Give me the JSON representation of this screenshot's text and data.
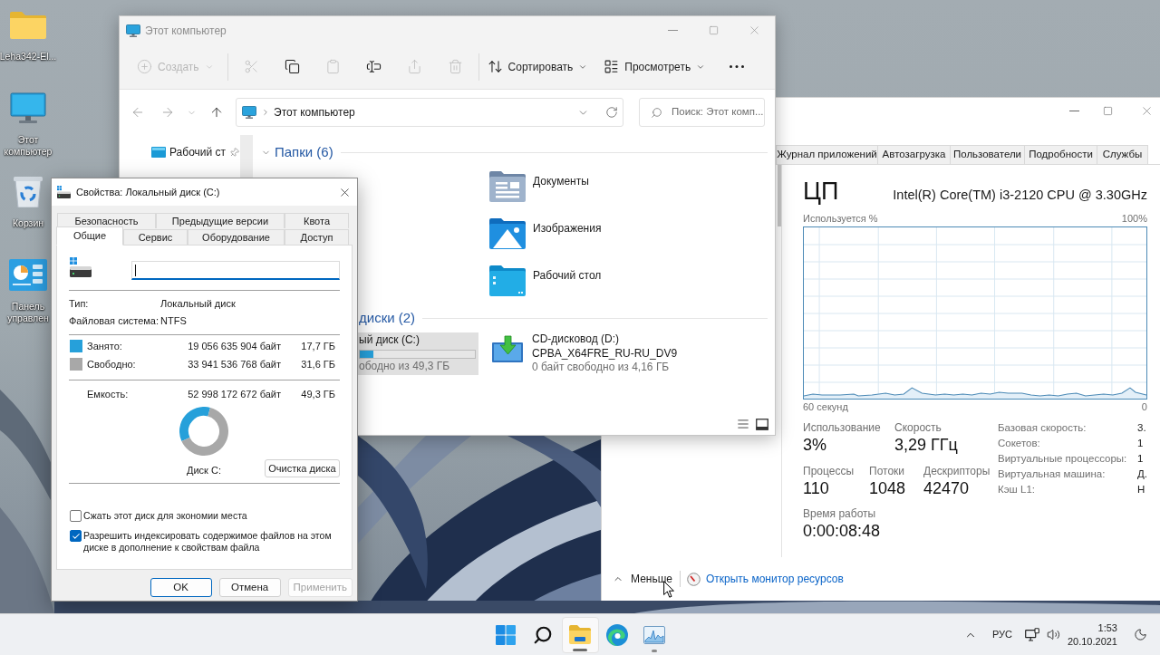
{
  "desktop": {
    "icons": [
      {
        "kind": "folder",
        "label": "Leha342-El..."
      },
      {
        "kind": "computer",
        "label": "Этот компьютер"
      },
      {
        "kind": "recycle-bin",
        "label": "Корзин"
      },
      {
        "kind": "control-panel",
        "label": "Панель управлен"
      }
    ]
  },
  "task_manager": {
    "tabs": [
      {
        "label": "Журнал приложений",
        "selected": false
      },
      {
        "label": "Автозагрузка",
        "selected": false
      },
      {
        "label": "Пользователи",
        "selected": false
      },
      {
        "label": "Подробности",
        "selected": false
      },
      {
        "label": "Службы",
        "selected": false
      }
    ],
    "cpu": {
      "title": "ЦП",
      "model": "Intel(R) Core(TM) i3-2120 CPU @ 3.30GHz",
      "graph_caption": "Используется %",
      "graph_max": "100%",
      "graph_span": "60 секунд",
      "graph_end": "0",
      "stats": [
        {
          "label": "Использование",
          "value": "3%"
        },
        {
          "label": "Скорость",
          "value": "3,29 ГГц"
        }
      ],
      "counts": [
        {
          "label": "Процессы",
          "value": "110"
        },
        {
          "label": "Потоки",
          "value": "1048"
        },
        {
          "label": "Дескрипторы",
          "value": "42470"
        }
      ],
      "uptime": {
        "label": "Время работы",
        "value": "0:00:08:48"
      },
      "details": [
        {
          "label": "Базовая скорость:",
          "value": "3."
        },
        {
          "label": "Сокетов:",
          "value": "1"
        },
        {
          "label": "Виртуальные процессоры:",
          "value": "1"
        },
        {
          "label": "Виртуальная машина:",
          "value": "Д."
        },
        {
          "label": "Кэш L1:",
          "value": "Н"
        }
      ]
    },
    "footer": {
      "toggle": "Меньше",
      "link": "Открыть монитор ресурсов"
    }
  },
  "explorer": {
    "title": "Этот компьютер",
    "active": false,
    "toolbar": [
      {
        "kind": "new",
        "label": "Создать",
        "disabled": true
      },
      {
        "kind": "cut",
        "disabled": true
      },
      {
        "kind": "copy",
        "disabled": false
      },
      {
        "kind": "paste",
        "disabled": true
      },
      {
        "kind": "rename",
        "disabled": false
      },
      {
        "kind": "share",
        "disabled": true
      },
      {
        "kind": "delete",
        "disabled": true
      },
      {
        "kind": "sort",
        "label": "Сортировать",
        "disabled": false
      },
      {
        "kind": "view",
        "label": "Просмотреть",
        "disabled": false
      },
      {
        "kind": "more",
        "disabled": false
      }
    ],
    "navigation": [
      {
        "kind": "back",
        "disabled": true
      },
      {
        "kind": "forward",
        "disabled": true
      },
      {
        "kind": "recent",
        "disabled": true
      },
      {
        "kind": "up",
        "disabled": false
      }
    ],
    "address": "Этот компьютер",
    "search": {
      "placeholder": "Поиск: Этот комп..."
    },
    "sidebar": {
      "items": [
        {
          "label": "Рабочий ст",
          "pinned": true
        }
      ]
    },
    "folders": {
      "title": "Папки (6)",
      "expanded": true,
      "items": [
        {
          "kind": "documents",
          "label": "Документы"
        },
        {
          "kind": "pictures",
          "label": "Изображения"
        },
        {
          "kind": "desktop",
          "label": "Рабочий стол"
        }
      ]
    },
    "drives": {
      "title": "диски (2)",
      "items": [
        {
          "kind": "local",
          "name": "ый диск (C:)",
          "level": 0.12,
          "free": "ободно из 49,3 ГБ",
          "selected": true
        },
        {
          "kind": "optical",
          "name": "CD-дисковод (D:)",
          "label": "CPBA_X64FRE_RU-RU_DV9",
          "free": "0 байт свободно из 4,16 ГБ",
          "selected": false
        }
      ]
    },
    "view_modes": [
      {
        "kind": "details"
      },
      {
        "kind": "tiles"
      }
    ]
  },
  "properties_dialog": {
    "title": "Свойства: Локальный диск (C:)",
    "active": true,
    "tab_rows": [
      [
        {
          "label": "Безопасность",
          "selected": false
        },
        {
          "label": "Предыдущие версии",
          "selected": false
        },
        {
          "label": "Квота",
          "selected": false
        }
      ],
      [
        {
          "label": "Общие",
          "selected": true
        },
        {
          "label": "Сервис",
          "selected": false
        },
        {
          "label": "Оборудование",
          "selected": false
        },
        {
          "label": "Доступ",
          "selected": false
        }
      ]
    ],
    "name_field": {
      "focused": true
    },
    "info": [
      {
        "label": "Тип:",
        "value": "Локальный диск"
      },
      {
        "label": "Файловая система:",
        "value": "NTFS"
      }
    ],
    "usage": [
      {
        "label": "Занято:",
        "bytes": "19 056 635 904 байт",
        "size": "17,7 ГБ",
        "color": "#26a0da"
      },
      {
        "label": "Свободно:",
        "bytes": "33 941 536 768 байт",
        "size": "31,6 ГБ",
        "color": "#a8a8a8"
      }
    ],
    "capacity": {
      "label": "Емкость:",
      "bytes": "52 998 172 672 байт",
      "size": "49,3 ГБ"
    },
    "chart_data": {
      "type": "donut",
      "values": [
        35.9,
        64.1
      ]
    },
    "disk_label": "Диск C:",
    "cleanup_button": "Очистка диска",
    "options": [
      {
        "label": "Сжать этот диск для экономии места",
        "checked": false
      },
      {
        "label": "Разрешить индексировать содержимое файлов на этом диске в дополнение к свойствам файла",
        "checked": true
      }
    ],
    "buttons": [
      {
        "label": "OK",
        "kind": "default",
        "disabled": false
      },
      {
        "label": "Отмена",
        "kind": "normal",
        "disabled": false
      },
      {
        "label": "Применить",
        "kind": "normal",
        "disabled": true
      }
    ]
  },
  "taskbar": {
    "apps": [
      {
        "kind": "start"
      },
      {
        "kind": "search"
      },
      {
        "kind": "explorer",
        "running": true,
        "active": true
      },
      {
        "kind": "edge",
        "running": false
      },
      {
        "kind": "task-manager",
        "running": true,
        "active": false
      }
    ],
    "tray": {
      "language": "РУС",
      "time": "1:53",
      "date": "20.10.2021"
    }
  }
}
